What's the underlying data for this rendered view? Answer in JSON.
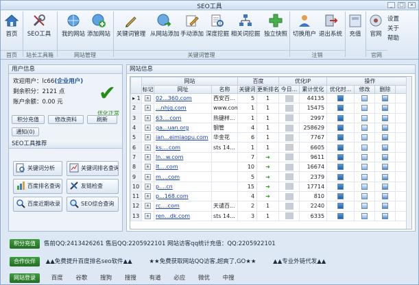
{
  "window": {
    "title": "SEO工具"
  },
  "ribbon": {
    "buttons": [
      {
        "id": "home",
        "label": "首页",
        "icon": "home-icon"
      },
      {
        "id": "seo-tool",
        "label": "SEO工具",
        "icon": "tools-icon"
      },
      {
        "id": "my-sites",
        "label": "我的网站",
        "icon": "globe-icon"
      },
      {
        "id": "add-site",
        "label": "添加网站",
        "icon": "globe-add-icon"
      },
      {
        "id": "keyword-manage",
        "label": "关键词管理",
        "icon": "pen-icon"
      },
      {
        "id": "add-from-site",
        "label": "从网站添加",
        "icon": "globe-arrow-icon"
      },
      {
        "id": "manual-add",
        "label": "手动添加",
        "icon": "edit-icon"
      },
      {
        "id": "depth-mining",
        "label": "深度挖掘",
        "icon": "document-search-icon"
      },
      {
        "id": "related-mining",
        "label": "相关词挖掘",
        "icon": "network-icon"
      },
      {
        "id": "snapshot",
        "label": "独立快照",
        "icon": "plus-icon"
      },
      {
        "id": "switch-user",
        "label": "切换用户",
        "icon": "user-switch-icon"
      },
      {
        "id": "logout",
        "label": "退出系统",
        "icon": "exit-icon"
      },
      {
        "id": "recharge",
        "label": "充值",
        "icon": "card-icon"
      },
      {
        "id": "official",
        "label": "官网",
        "icon": "official-icon"
      },
      {
        "id": "settings",
        "label": "设置",
        "icon": "settings-text"
      },
      {
        "id": "about",
        "label": "关于",
        "icon": "about-text"
      },
      {
        "id": "help",
        "label": "帮助",
        "icon": "help-text"
      }
    ],
    "groups": [
      "首页",
      "站长工具箱",
      "网站管理",
      "关键词管理",
      "注销",
      "官网"
    ]
  },
  "user_info": {
    "header": "用户信息",
    "welcome_prefix": "欢迎用户：lc66",
    "welcome_type": "(企业用户)",
    "points": "剩余积分：2121 点",
    "balance": "账户余额：0.00 元",
    "status": "优化正常",
    "buttons": [
      "积分充值",
      "修改资料",
      "刷新",
      "通知(0)"
    ]
  },
  "tools": {
    "header": "SEO工具推荐",
    "items": [
      {
        "label": "关键词分析",
        "icon": "keyword-analysis-icon"
      },
      {
        "label": "关键词排名查询",
        "icon": "rank-query-icon"
      },
      {
        "label": "百度排名查询",
        "icon": "baidu-rank-icon"
      },
      {
        "label": "友链检查",
        "icon": "link-check-icon"
      },
      {
        "label": "百度近期收录",
        "icon": "baidu-index-icon"
      },
      {
        "label": "SEO综合查询",
        "icon": "seo-query-icon"
      }
    ]
  },
  "grid": {
    "header": "网站信息",
    "group_headers": [
      "网站",
      "百度",
      "优化IP",
      "操作"
    ],
    "columns": [
      "标记",
      "网址",
      "名称",
      "关键词",
      "更新排名",
      "今日...",
      "累计优化",
      "优化时...",
      "修改",
      "删除"
    ],
    "rows": [
      {
        "n": "1",
        "url": "02...360.com",
        "name": "西安百...",
        "kw": "5",
        "rank": "1",
        "total": "44135"
      },
      {
        "n": "2",
        "url": "...nhjq.com",
        "name": "www.com",
        "kw": "1",
        "rank": "1",
        "total": "15475"
      },
      {
        "n": "3",
        "url": "63....com",
        "name": "热键样...",
        "kw": "1",
        "rank": "1",
        "total": "2997"
      },
      {
        "n": "4",
        "url": "ga...uan.org",
        "name": "钢管",
        "kw": "4",
        "rank": "1",
        "total": "258629"
      },
      {
        "n": "5",
        "url": "ian...eimiaopu.com",
        "name": "华金花",
        "kw": "6",
        "rank": "1",
        "total": "7767"
      },
      {
        "n": "6",
        "url": "ks....com",
        "name": "sts 14...",
        "kw": "1",
        "rank": "1",
        "total": "6605"
      },
      {
        "n": "7",
        "url": "ln...w.com",
        "name": "",
        "kw": "7",
        "rank": "arrow",
        "total": "9611"
      },
      {
        "n": "8",
        "url": "lt....com",
        "name": "",
        "kw": "10",
        "rank": "arrow",
        "total": "16674"
      },
      {
        "n": "9",
        "url": "m....com",
        "name": "",
        "kw": "5",
        "rank": "arrow",
        "total": "2379"
      },
      {
        "n": "10",
        "url": "p....cn",
        "name": "",
        "kw": "15",
        "rank": "arrow",
        "total": "17714"
      },
      {
        "n": "11",
        "url": "p...168.com",
        "name": "",
        "kw": "4",
        "rank": "arrow",
        "total": "810"
      },
      {
        "n": "12",
        "url": "rc....com",
        "name": "天谴百...",
        "kw": "2",
        "rank": "1",
        "total": "2240"
      },
      {
        "n": "13",
        "url": "ren...dk.com",
        "name": "sts 14...",
        "kw": "3",
        "rank": "1",
        "total": "6335"
      }
    ]
  },
  "bottom": {
    "bar1_tag": "积分充值",
    "bar1_text": "售前QQ:2413426261  售后QQ:2205922101  网站访客qq统计充值：QQ:2205922101",
    "bar2_tag": "合作伙伴",
    "bar2_items": [
      "▲▲免费提升百度排名seo软件▲▲",
      "★★免费获取网站QQ访客,超爽了,GO★★",
      "▲▲专业外链代发▲▲"
    ],
    "bar3_tag": "网站登录",
    "bar3_items": [
      "百度",
      "谷歌",
      "搜狗",
      "搜搜",
      "有道",
      "必应",
      "微优",
      "中搜"
    ]
  }
}
